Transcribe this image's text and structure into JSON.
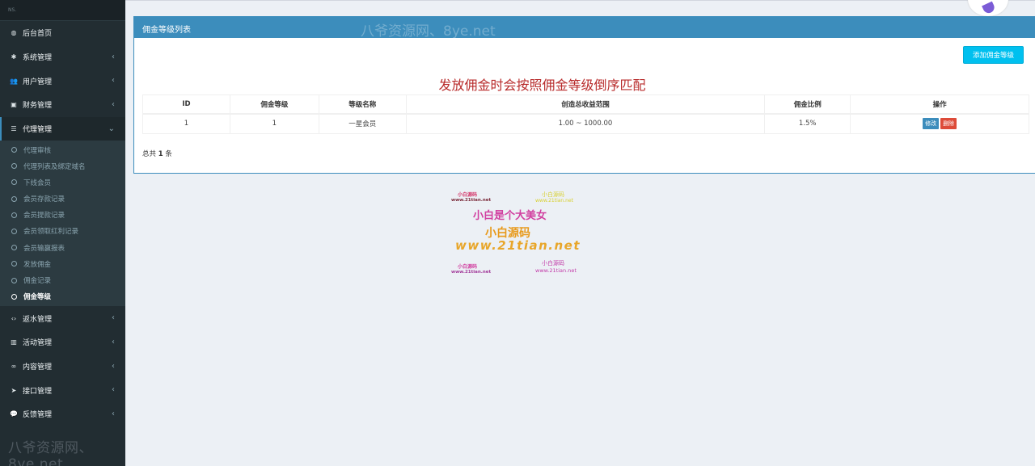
{
  "logo": {
    "text": "NS."
  },
  "sidebar": {
    "items": [
      {
        "label": "后台首页",
        "icon": "dashboard-icon",
        "glyph": "◍",
        "chevron": ""
      },
      {
        "label": "系统管理",
        "icon": "gear-icon",
        "glyph": "✱",
        "chevron": "‹"
      },
      {
        "label": "用户管理",
        "icon": "users-icon",
        "glyph": "👥",
        "chevron": "‹"
      },
      {
        "label": "财务管理",
        "icon": "money-icon",
        "glyph": "▣",
        "chevron": "‹"
      },
      {
        "label": "代理管理",
        "icon": "list-icon",
        "glyph": "☰",
        "chevron": "⌄"
      }
    ],
    "submenu": [
      {
        "label": "代理审核"
      },
      {
        "label": "代理列表及绑定域名"
      },
      {
        "label": "下线会员"
      },
      {
        "label": "会员存款记录"
      },
      {
        "label": "会员提款记录"
      },
      {
        "label": "会员领取红利记录"
      },
      {
        "label": "会员输赢报表"
      },
      {
        "label": "发放佣金"
      },
      {
        "label": "佣金记录"
      },
      {
        "label": "佣金等级"
      }
    ],
    "items_after": [
      {
        "label": "返水管理",
        "icon": "code-icon",
        "glyph": "‹›",
        "chevron": "‹"
      },
      {
        "label": "活动管理",
        "icon": "map-icon",
        "glyph": "▥",
        "chevron": "‹"
      },
      {
        "label": "内容管理",
        "icon": "link-icon",
        "glyph": "∞",
        "chevron": "‹"
      },
      {
        "label": "接口管理",
        "icon": "paper-plane-icon",
        "glyph": "➤",
        "chevron": "‹"
      },
      {
        "label": "反馈管理",
        "icon": "comments-icon",
        "glyph": "💬",
        "chevron": "‹"
      }
    ],
    "watermark": "八爷资源网、8ye.net"
  },
  "box": {
    "title": "佣金等级列表",
    "watermark": "八爷资源网、8ye.net",
    "add_button": "添加佣金等级",
    "notice": "发放佣金时会按照佣金等级倒序匹配",
    "columns": [
      "ID",
      "佣金等级",
      "等级名称",
      "创造总收益范围",
      "佣金比例",
      "操作"
    ],
    "rows": [
      {
        "id": "1",
        "level": "1",
        "name": "一星会员",
        "range": "1.00 ~ 1000.00",
        "ratio": "1.5%",
        "edit": "修改",
        "delete": "删除"
      }
    ],
    "total_prefix": "总共",
    "total_count": "1",
    "total_suffix": "条"
  },
  "content_watermark": {
    "small1_title": "小白源码",
    "small1_url": "www.21tian.net",
    "small2_title": "小白源码",
    "small2_url": "www.21tian.net",
    "headline": "小白是个大美女",
    "brand": "小白源码",
    "url": "www.21tian.net",
    "small3_title": "小白源码",
    "small3_url": "www.21tian.net",
    "small4_title": "小白源码",
    "small4_url": "www.21tian.net"
  },
  "colors": {
    "sidebar_bg": "#222d32",
    "header_blue": "#3c8dbc",
    "add_button": "#00c0ef",
    "notice_red": "#b82b2b",
    "delete_red": "#dd4b39"
  }
}
